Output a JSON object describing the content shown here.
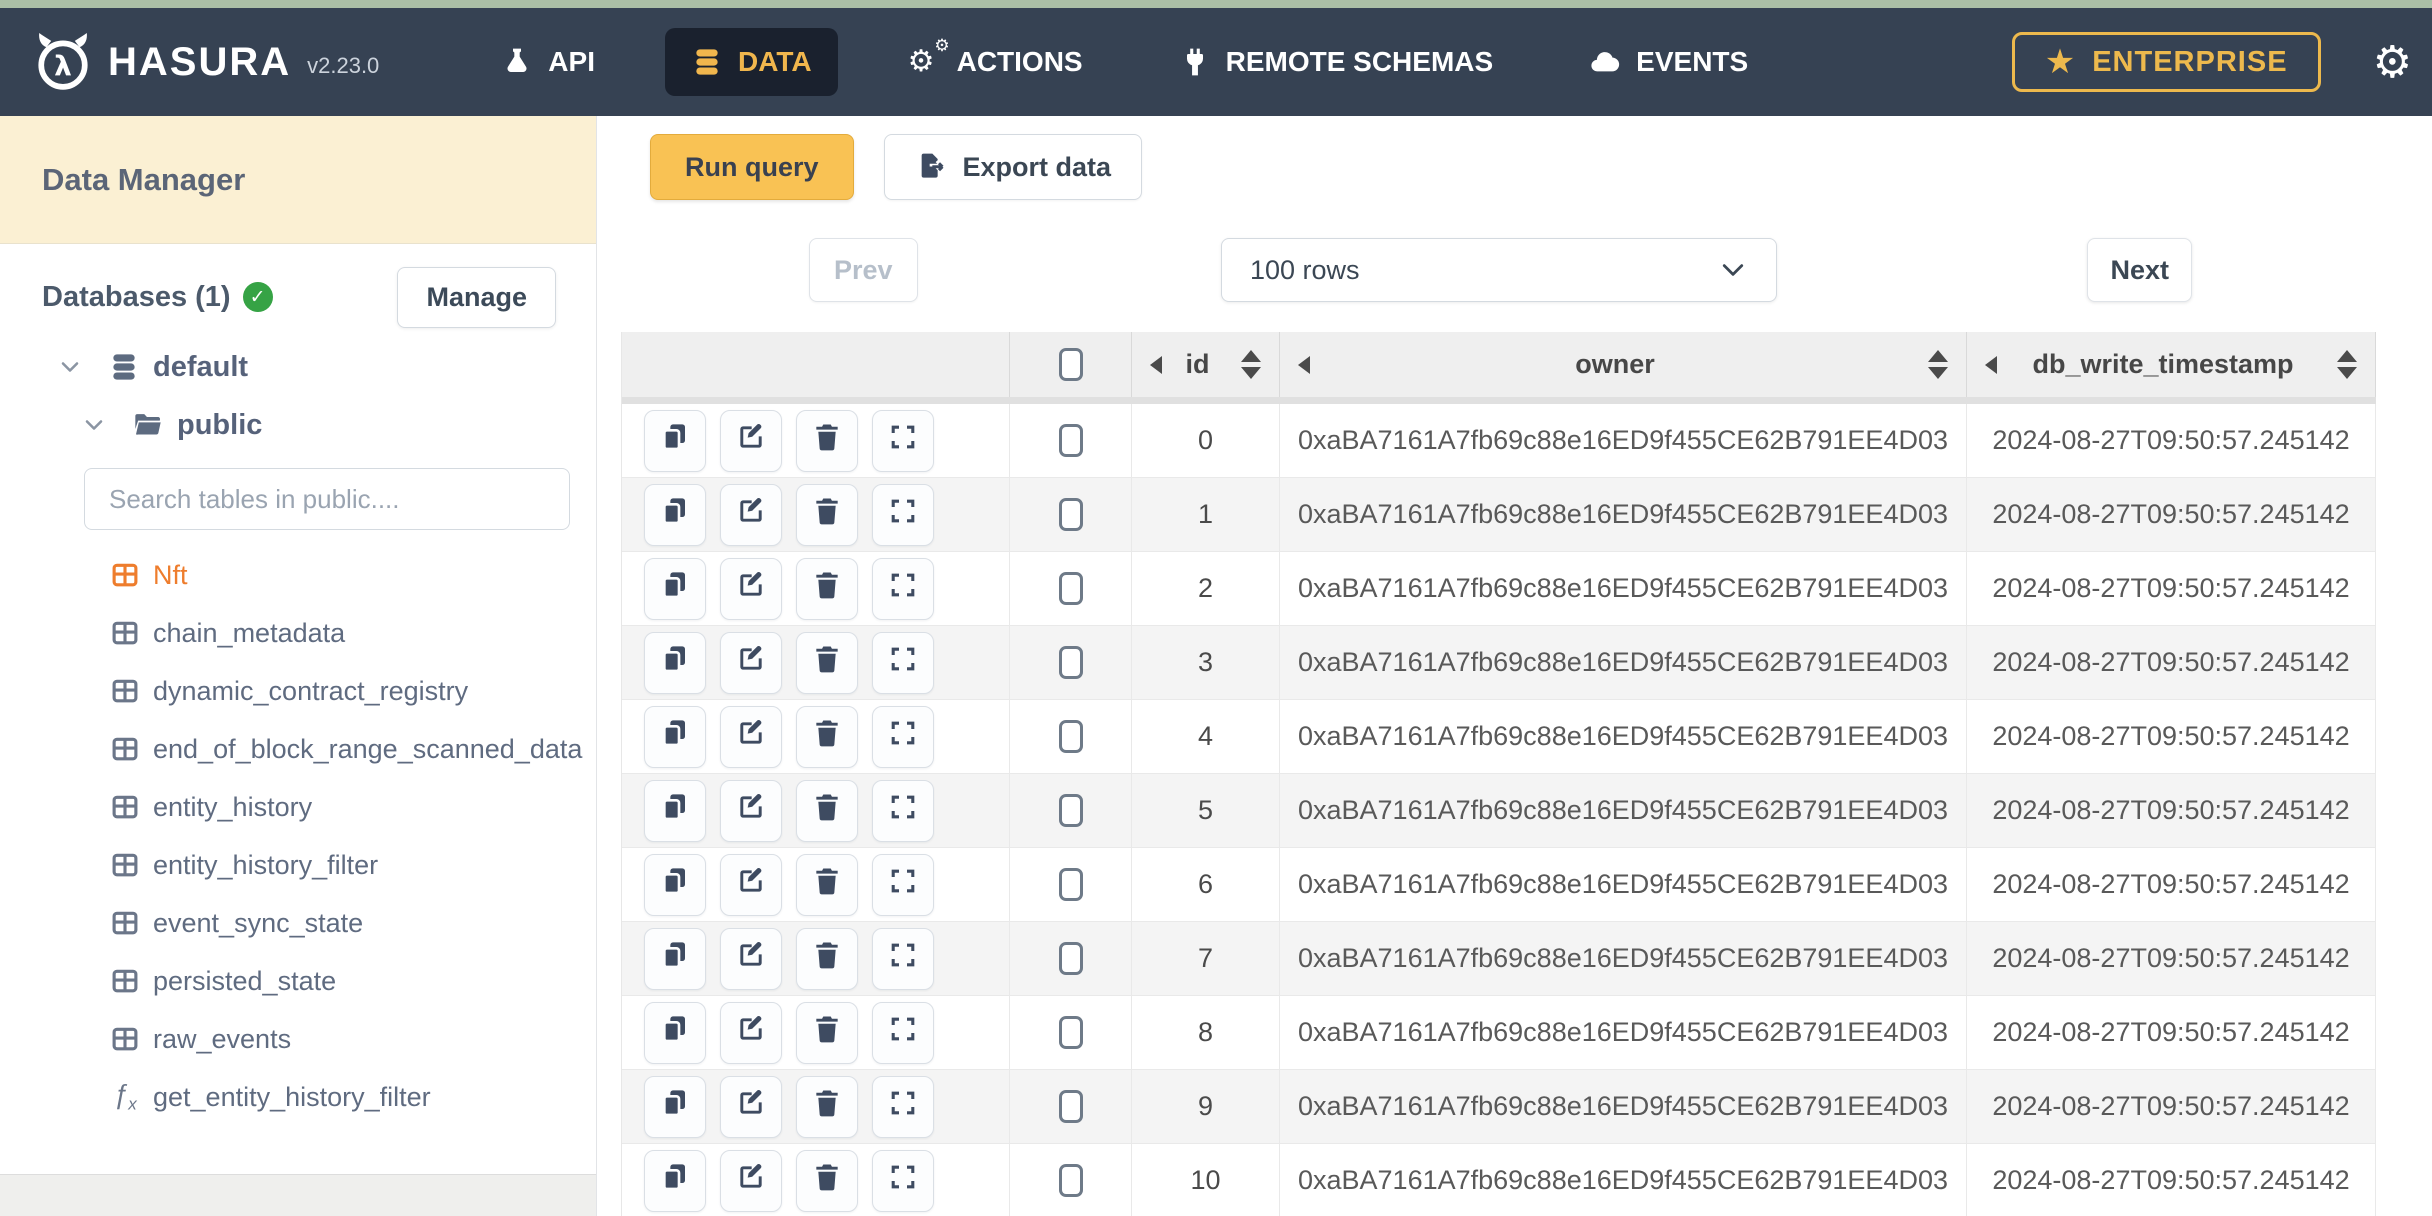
{
  "nav": {
    "brand": "HASURA",
    "logo_glyph": "λ",
    "version": "v2.23.0",
    "items": [
      {
        "label": "API",
        "icon": "flask-icon",
        "active": false
      },
      {
        "label": "DATA",
        "icon": "database-icon",
        "active": true
      },
      {
        "label": "ACTIONS",
        "icon": "gears-icon",
        "active": false
      },
      {
        "label": "REMOTE SCHEMAS",
        "icon": "plug-icon",
        "active": false
      },
      {
        "label": "EVENTS",
        "icon": "cloud-icon",
        "active": false
      }
    ],
    "enterprise_label": "ENTERPRISE",
    "enterprise_color": "#edb94d",
    "gear_glyph": "⚙",
    "star_glyph": "★"
  },
  "sidebar": {
    "title": "Data Manager",
    "databases_label": "Databases (1)",
    "check_glyph": "✓",
    "manage_label": "Manage",
    "tree": {
      "database": "default",
      "schema": "public"
    },
    "search_placeholder": "Search tables in public....",
    "tables": [
      {
        "name": "Nft",
        "type": "table",
        "active": true
      },
      {
        "name": "chain_metadata",
        "type": "table",
        "active": false
      },
      {
        "name": "dynamic_contract_registry",
        "type": "table",
        "active": false
      },
      {
        "name": "end_of_block_range_scanned_data",
        "type": "table",
        "active": false
      },
      {
        "name": "entity_history",
        "type": "table",
        "active": false
      },
      {
        "name": "entity_history_filter",
        "type": "table",
        "active": false
      },
      {
        "name": "event_sync_state",
        "type": "table",
        "active": false
      },
      {
        "name": "persisted_state",
        "type": "table",
        "active": false
      },
      {
        "name": "raw_events",
        "type": "table",
        "active": false
      },
      {
        "name": "get_entity_history_filter",
        "type": "function",
        "active": false
      }
    ],
    "active_color": "#ee7d2d"
  },
  "toolbar": {
    "run_query": "Run query",
    "export_data": "Export data",
    "run_query_color": "#f9c254"
  },
  "pagination": {
    "prev": "Prev",
    "rows_select": "100 rows",
    "next": "Next"
  },
  "table": {
    "columns": [
      "id",
      "owner",
      "db_write_timestamp"
    ],
    "rows": [
      {
        "id": "0",
        "owner": "0xaBA7161A7fb69c88e16ED9f455CE62B791EE4D03",
        "db_write_timestamp": "2024-08-27T09:50:57.245142"
      },
      {
        "id": "1",
        "owner": "0xaBA7161A7fb69c88e16ED9f455CE62B791EE4D03",
        "db_write_timestamp": "2024-08-27T09:50:57.245142"
      },
      {
        "id": "2",
        "owner": "0xaBA7161A7fb69c88e16ED9f455CE62B791EE4D03",
        "db_write_timestamp": "2024-08-27T09:50:57.245142"
      },
      {
        "id": "3",
        "owner": "0xaBA7161A7fb69c88e16ED9f455CE62B791EE4D03",
        "db_write_timestamp": "2024-08-27T09:50:57.245142"
      },
      {
        "id": "4",
        "owner": "0xaBA7161A7fb69c88e16ED9f455CE62B791EE4D03",
        "db_write_timestamp": "2024-08-27T09:50:57.245142"
      },
      {
        "id": "5",
        "owner": "0xaBA7161A7fb69c88e16ED9f455CE62B791EE4D03",
        "db_write_timestamp": "2024-08-27T09:50:57.245142"
      },
      {
        "id": "6",
        "owner": "0xaBA7161A7fb69c88e16ED9f455CE62B791EE4D03",
        "db_write_timestamp": "2024-08-27T09:50:57.245142"
      },
      {
        "id": "7",
        "owner": "0xaBA7161A7fb69c88e16ED9f455CE62B791EE4D03",
        "db_write_timestamp": "2024-08-27T09:50:57.245142"
      },
      {
        "id": "8",
        "owner": "0xaBA7161A7fb69c88e16ED9f455CE62B791EE4D03",
        "db_write_timestamp": "2024-08-27T09:50:57.245142"
      },
      {
        "id": "9",
        "owner": "0xaBA7161A7fb69c88e16ED9f455CE62B791EE4D03",
        "db_write_timestamp": "2024-08-27T09:50:57.245142"
      },
      {
        "id": "10",
        "owner": "0xaBA7161A7fb69c88e16ED9f455CE62B791EE4D03",
        "db_write_timestamp": "2024-08-27T09:50:57.245142"
      }
    ]
  }
}
